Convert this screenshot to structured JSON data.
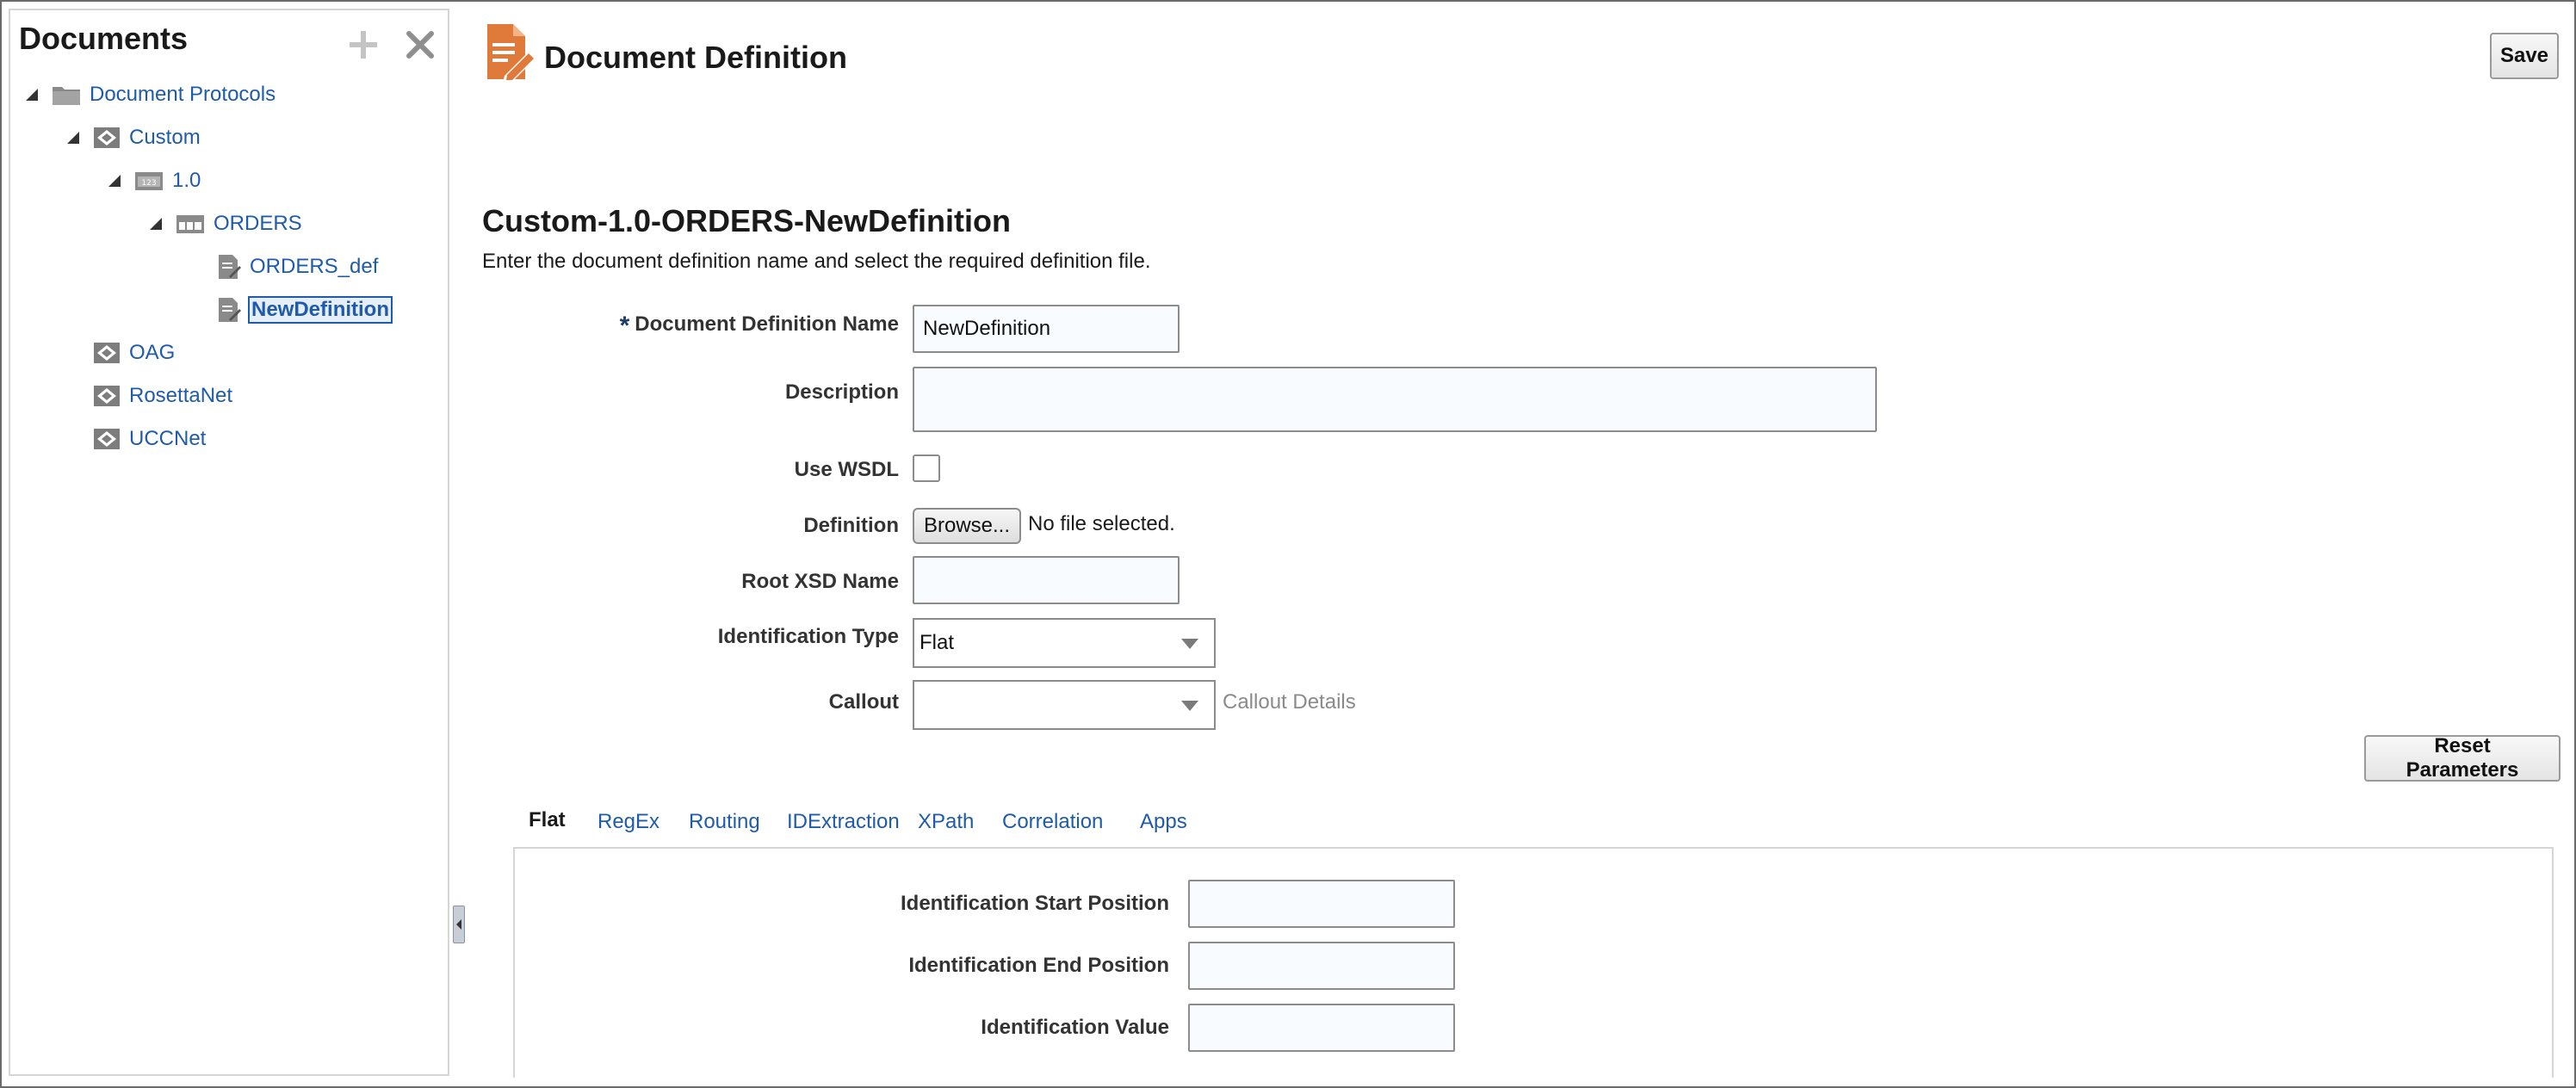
{
  "left_panel": {
    "title": "Documents",
    "tree": [
      {
        "label": "Document Protocols",
        "type": "folder"
      },
      {
        "label": "Custom",
        "type": "protocol"
      },
      {
        "label": "1.0",
        "type": "version"
      },
      {
        "label": "ORDERS",
        "type": "doctype"
      },
      {
        "label": "ORDERS_def",
        "type": "definition"
      },
      {
        "label": "NewDefinition",
        "type": "definition",
        "selected": true
      },
      {
        "label": "OAG",
        "type": "protocol"
      },
      {
        "label": "RosettaNet",
        "type": "protocol"
      },
      {
        "label": "UCCNet",
        "type": "protocol"
      }
    ]
  },
  "header": {
    "title": "Document Definition",
    "save_label": "Save"
  },
  "form": {
    "section_title": "Custom-1.0-ORDERS-NewDefinition",
    "instructions": "Enter the document definition name and select the required definition file.",
    "required_marker": "*",
    "name_label": "Document Definition Name",
    "name_value": "NewDefinition",
    "description_label": "Description",
    "description_value": "",
    "use_wsdl_label": "Use WSDL",
    "definition_label": "Definition",
    "browse_label": "Browse...",
    "no_file_text": "No file selected.",
    "root_xsd_label": "Root XSD Name",
    "root_xsd_value": "",
    "identification_type_label": "Identification Type",
    "identification_type_value": "Flat",
    "callout_label": "Callout",
    "callout_value": "",
    "callout_details": "Callout Details",
    "reset_label": "Reset Parameters"
  },
  "tabs": {
    "items": [
      "Flat",
      "RegEx",
      "Routing",
      "IDExtraction",
      "XPath",
      "Correlation",
      "Apps"
    ],
    "active": "Flat"
  },
  "flat_tab": {
    "start_label": "Identification Start Position",
    "end_label": "Identification End Position",
    "value_label": "Identification Value"
  },
  "colors": {
    "link": "#1f5bab",
    "accent_orange": "#e07a3a",
    "border": "#8c8c8c"
  }
}
